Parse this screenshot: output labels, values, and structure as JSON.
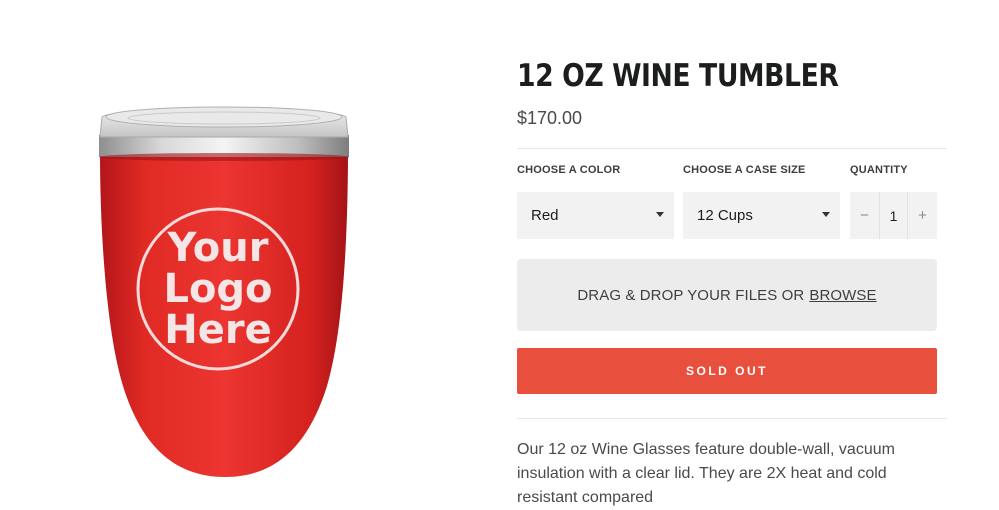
{
  "product": {
    "title": "12 OZ WINE TUMBLER",
    "price": "$170.00",
    "image": {
      "logo_text_line1": "Your",
      "logo_text_line2": "Logo",
      "logo_text_line3": "Here",
      "color": "#d9261c"
    }
  },
  "options": {
    "color": {
      "label": "CHOOSE A COLOR",
      "selected": "Red"
    },
    "case_size": {
      "label": "CHOOSE A CASE SIZE",
      "selected": "12 Cups"
    },
    "quantity": {
      "label": "QUANTITY",
      "value": "1",
      "minus": "−",
      "plus": "+"
    }
  },
  "upload": {
    "text": "DRAG & DROP YOUR FILES OR",
    "browse_label": "BROWSE"
  },
  "cta": {
    "label": "SOLD OUT",
    "color": "#e94f3d"
  },
  "description": "Our 12 oz Wine Glasses feature double-wall, vacuum insulation with a clear lid. They are 2X heat and cold resistant compared"
}
